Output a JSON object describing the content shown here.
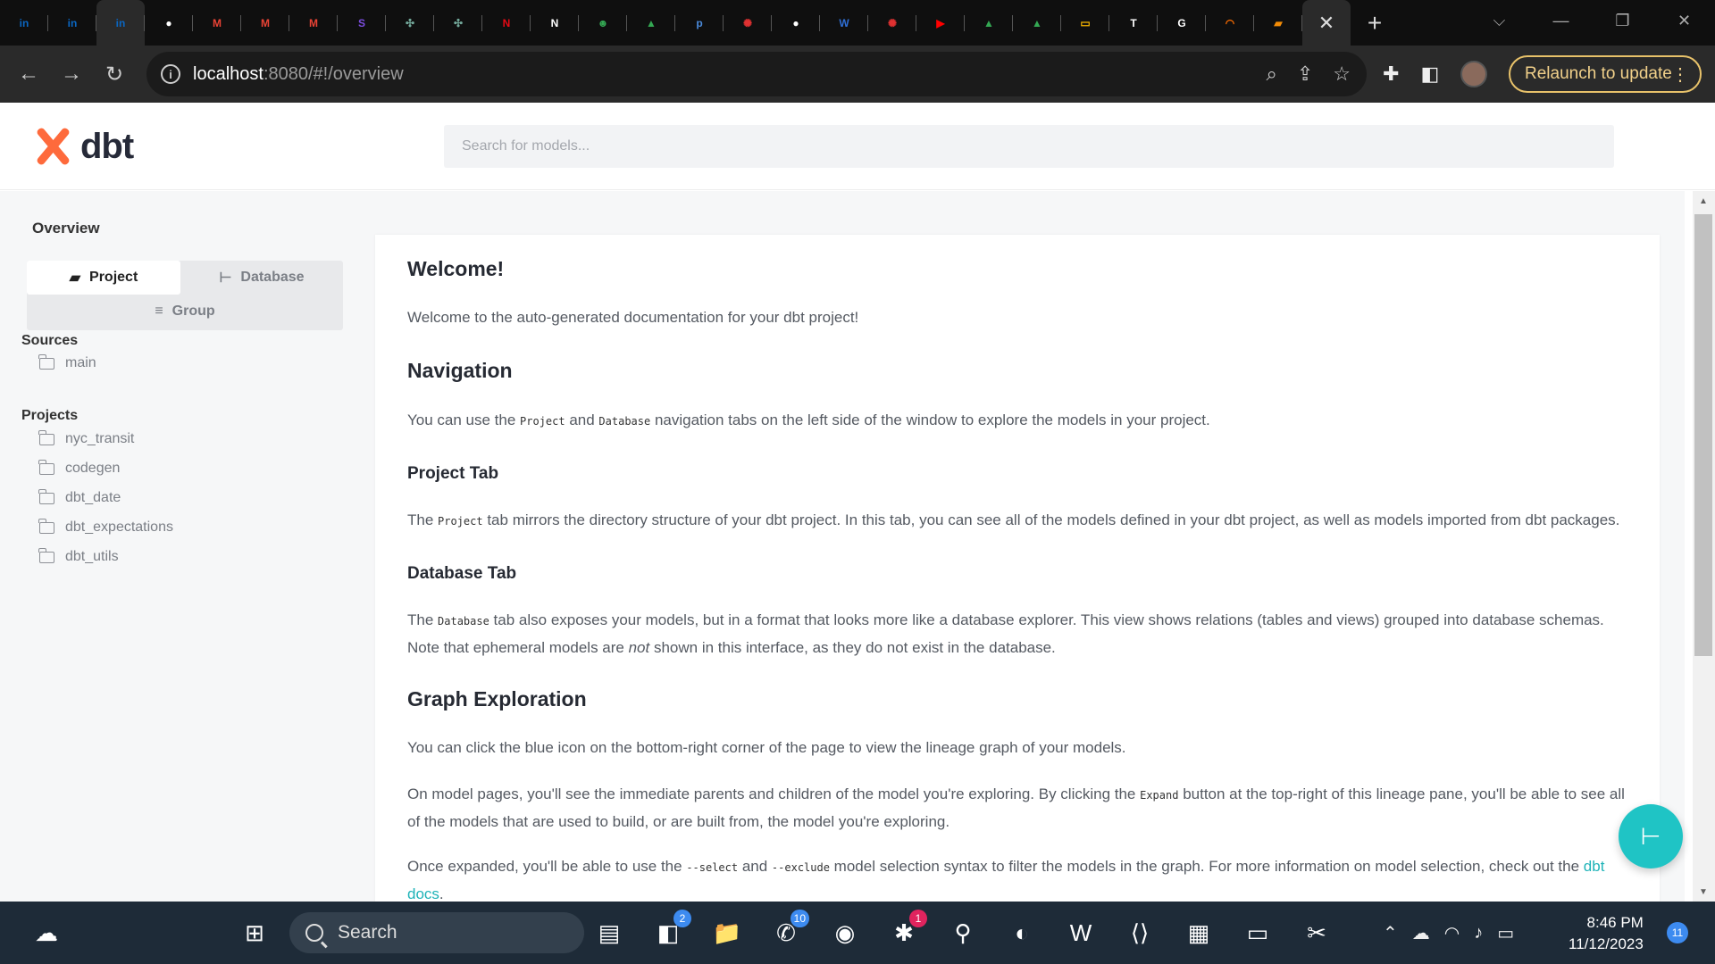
{
  "browser": {
    "tabs": [
      {
        "icon": "linkedin-icon",
        "glyph": "in",
        "color": "#0a66c2"
      },
      {
        "icon": "linkedin-icon",
        "glyph": "in",
        "color": "#0a66c2"
      },
      {
        "icon": "linkedin-icon",
        "glyph": "in",
        "color": "#0a66c2"
      },
      {
        "icon": "github-icon",
        "glyph": "●",
        "color": "#ffffff"
      },
      {
        "icon": "gmail-icon",
        "glyph": "M",
        "color": "#ea4335"
      },
      {
        "icon": "gmail-icon",
        "glyph": "M",
        "color": "#ea4335"
      },
      {
        "icon": "gmail-icon",
        "glyph": "M",
        "color": "#ea4335"
      },
      {
        "icon": "s-app-icon",
        "glyph": "S",
        "color": "#7b4de0"
      },
      {
        "icon": "chatgpt-icon",
        "glyph": "✣",
        "color": "#74aa9c"
      },
      {
        "icon": "chatgpt-icon",
        "glyph": "✣",
        "color": "#74aa9c"
      },
      {
        "icon": "netflix-icon",
        "glyph": "N",
        "color": "#e50914"
      },
      {
        "icon": "notion-icon",
        "glyph": "N",
        "color": "#ffffff"
      },
      {
        "icon": "robot-icon",
        "glyph": "☻",
        "color": "#34a853"
      },
      {
        "icon": "google-drive-icon",
        "glyph": "▲",
        "color": "#34a853"
      },
      {
        "icon": "p-app-icon",
        "glyph": "p",
        "color": "#4b8bdc"
      },
      {
        "icon": "asterisk-red-icon",
        "glyph": "✺",
        "color": "#e03131"
      },
      {
        "icon": "github-icon",
        "glyph": "●",
        "color": "#ffffff"
      },
      {
        "icon": "w-app-icon",
        "glyph": "W",
        "color": "#2f6fd6"
      },
      {
        "icon": "asterisk-red-icon",
        "glyph": "✺",
        "color": "#e03131"
      },
      {
        "icon": "youtube-icon",
        "glyph": "▶",
        "color": "#ff0000"
      },
      {
        "icon": "google-drive-icon",
        "glyph": "▲",
        "color": "#34a853"
      },
      {
        "icon": "google-drive-icon",
        "glyph": "▲",
        "color": "#34a853"
      },
      {
        "icon": "slides-icon",
        "glyph": "▭",
        "color": "#f4b400"
      },
      {
        "icon": "t-app-icon",
        "glyph": "T",
        "color": "#ffffff"
      },
      {
        "icon": "google-icon",
        "glyph": "G",
        "color": "#ffffff"
      },
      {
        "icon": "arc-icon",
        "glyph": "◠",
        "color": "#ff6d00"
      },
      {
        "icon": "book-icon",
        "glyph": "▰",
        "color": "#f48c06"
      }
    ],
    "close_tab_glyph": "✕",
    "new_tab_glyph": "+",
    "window_controls": {
      "chevron": "⌵",
      "minimize": "—",
      "restore": "❐",
      "close": "✕"
    },
    "url_host": "localhost",
    "url_rest": ":8080/#!/overview",
    "relaunch_label": "Relaunch to update"
  },
  "app": {
    "logo_text": "dbt",
    "search_placeholder": "Search for models...",
    "sidebar": {
      "overview": "Overview",
      "tabs": {
        "project": "Project",
        "database": "Database",
        "group": "Group"
      },
      "sources_heading": "Sources",
      "sources": [
        "main"
      ],
      "projects_heading": "Projects",
      "projects": [
        "nyc_transit",
        "codegen",
        "dbt_date",
        "dbt_expectations",
        "dbt_utils"
      ]
    },
    "doc": {
      "welcome_title": "Welcome!",
      "welcome_text": "Welcome to the auto-generated documentation for your dbt project!",
      "nav_title": "Navigation",
      "nav_p1": "You can use the ",
      "nav_code1": "Project",
      "nav_p2": " and ",
      "nav_code2": "Database",
      "nav_p3": " navigation tabs on the left side of the window to explore the models in your project.",
      "project_tab_title": "Project Tab",
      "project_p1": "The ",
      "project_code": "Project",
      "project_p2": " tab mirrors the directory structure of your dbt project. In this tab, you can see all of the models defined in your dbt project, as well as models imported from dbt packages.",
      "database_tab_title": "Database Tab",
      "database_p1": "The ",
      "database_code": "Database",
      "database_p2": " tab also exposes your models, but in a format that looks more like a database explorer. This view shows relations (tables and views) grouped into database schemas. Note that ephemeral models are ",
      "database_em": "not",
      "database_p3": " shown in this interface, as they do not exist in the database.",
      "graph_title": "Graph Exploration",
      "graph_p": "You can click the blue icon on the bottom-right corner of the page to view the lineage graph of your models.",
      "model_p1": "On model pages, you'll see the immediate parents and children of the model you're exploring. By clicking the ",
      "model_code": "Expand",
      "model_p2": " button at the top-right of this lineage pane, you'll be able to see all of the models that are used to build, or are built from, the model you're exploring.",
      "expanded_p1": "Once expanded, you'll be able to use the ",
      "expanded_code1": "--select",
      "expanded_p2": " and ",
      "expanded_code2": "--exclude",
      "expanded_p3": " model selection syntax to filter the models in the graph. For more information on model selection, check out the ",
      "expanded_link": "dbt docs",
      "expanded_p4": "."
    }
  },
  "taskbar": {
    "search_label": "Search",
    "apps": [
      {
        "icon": "widgets-weather-icon",
        "glyph": "☁",
        "badge": ""
      },
      {
        "icon": "windows-start-icon",
        "glyph": "⊞",
        "badge": ""
      },
      {
        "icon": "file-explorer-stack-icon",
        "glyph": "▤",
        "badge": ""
      },
      {
        "icon": "teams-icon",
        "glyph": "◧",
        "badge": "2"
      },
      {
        "icon": "file-explorer-icon",
        "glyph": "📁",
        "badge": ""
      },
      {
        "icon": "whatsapp-icon",
        "glyph": "✆",
        "badge": "10"
      },
      {
        "icon": "chrome-icon",
        "glyph": "◉",
        "badge": ""
      },
      {
        "icon": "slack-icon",
        "glyph": "✱",
        "badge": "1"
      },
      {
        "icon": "maps-pin-icon",
        "glyph": "⚲",
        "badge": ""
      },
      {
        "icon": "edge-icon",
        "glyph": "◐",
        "badge": ""
      },
      {
        "icon": "word-icon",
        "glyph": "W",
        "badge": ""
      },
      {
        "icon": "vscode-icon",
        "glyph": "⟨⟩",
        "badge": ""
      },
      {
        "icon": "notepad-icon",
        "glyph": "▦",
        "badge": ""
      },
      {
        "icon": "terminal-icon",
        "glyph": "▭",
        "badge": ""
      },
      {
        "icon": "snipping-tool-icon",
        "glyph": "✂",
        "badge": ""
      }
    ],
    "time": "8:46 PM",
    "date": "11/12/2023",
    "notification_count": "11"
  }
}
